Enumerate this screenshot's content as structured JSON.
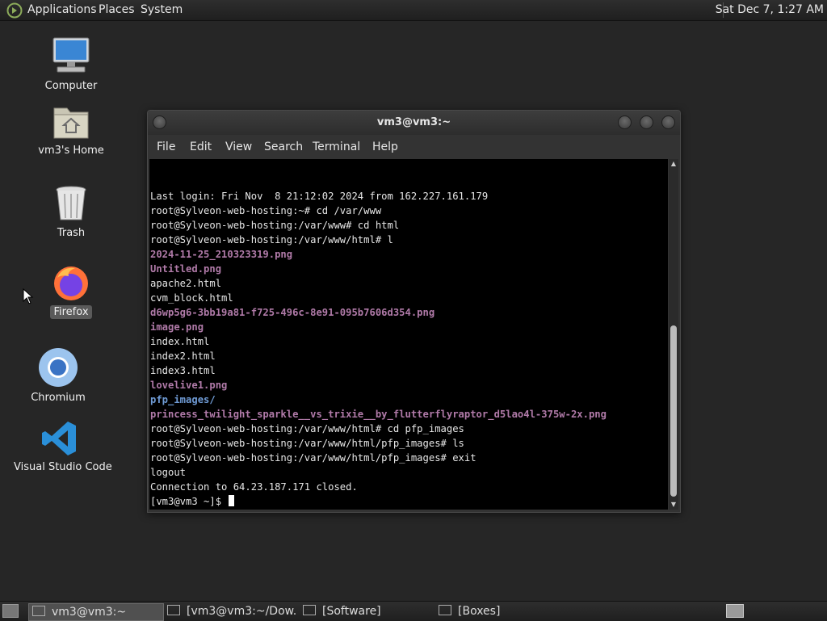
{
  "top_panel": {
    "menus": [
      "Applications",
      "Places",
      "System"
    ],
    "clock": "Sat Dec 7, 1:27 AM"
  },
  "desktop_icons": [
    {
      "label": "Computer",
      "icon": "computer-icon"
    },
    {
      "label": "vm3's Home",
      "icon": "home-folder-icon"
    },
    {
      "label": "Trash",
      "icon": "trash-icon"
    },
    {
      "label": "Firefox",
      "icon": "firefox-icon"
    },
    {
      "label": "Chromium",
      "icon": "chromium-icon"
    },
    {
      "label": "Visual Studio Code",
      "icon": "vscode-icon"
    }
  ],
  "terminal": {
    "title": "vm3@vm3:~",
    "menu": [
      "File",
      "Edit",
      "View",
      "Search",
      "Terminal",
      "Help"
    ],
    "lines": [
      {
        "text": "Last login: Fri Nov  8 21:12:02 2024 from 162.227.161.179",
        "kind": "normal"
      },
      {
        "text": "root@Sylveon-web-hosting:~# cd /var/www",
        "kind": "normal"
      },
      {
        "text": "root@Sylveon-web-hosting:/var/www# cd html",
        "kind": "normal"
      },
      {
        "text": "root@Sylveon-web-hosting:/var/www/html# l",
        "kind": "normal"
      },
      {
        "text": "2024-11-25_210323319.png",
        "kind": "img"
      },
      {
        "text": "Untitled.png",
        "kind": "img"
      },
      {
        "text": "apache2.html",
        "kind": "normal"
      },
      {
        "text": "cvm_block.html",
        "kind": "normal"
      },
      {
        "text": "d6wp5g6-3bb19a81-f725-496c-8e91-095b7606d354.png",
        "kind": "img"
      },
      {
        "text": "image.png",
        "kind": "img"
      },
      {
        "text": "index.html",
        "kind": "normal"
      },
      {
        "text": "index2.html",
        "kind": "normal"
      },
      {
        "text": "index3.html",
        "kind": "normal"
      },
      {
        "text": "lovelive1.png",
        "kind": "img"
      },
      {
        "text": "pfp_images/",
        "kind": "dir"
      },
      {
        "text": "princess_twilight_sparkle__vs_trixie__by_flutterflyraptor_d5lao4l-375w-2x.png",
        "kind": "img"
      },
      {
        "text": "root@Sylveon-web-hosting:/var/www/html# cd pfp_images",
        "kind": "normal"
      },
      {
        "text": "root@Sylveon-web-hosting:/var/www/html/pfp_images# ls",
        "kind": "normal"
      },
      {
        "text": "root@Sylveon-web-hosting:/var/www/html/pfp_images# exit",
        "kind": "normal"
      },
      {
        "text": "logout",
        "kind": "normal"
      },
      {
        "text": "Connection to 64.23.187.171 closed.",
        "kind": "normal"
      }
    ],
    "prompt": "[vm3@vm3 ~]$ "
  },
  "taskbar": {
    "tasks": [
      {
        "label": "vm3@vm3:~",
        "active": true
      },
      {
        "label": "[vm3@vm3:~/Dow...",
        "active": false
      },
      {
        "label": "[Software]",
        "active": false
      },
      {
        "label": "[Boxes]",
        "active": false
      }
    ]
  },
  "colors": {
    "desktop_bg": "#262626",
    "terminal_bg": "#000000",
    "image_file": "#b07aa8",
    "directory": "#6f9bd5"
  }
}
